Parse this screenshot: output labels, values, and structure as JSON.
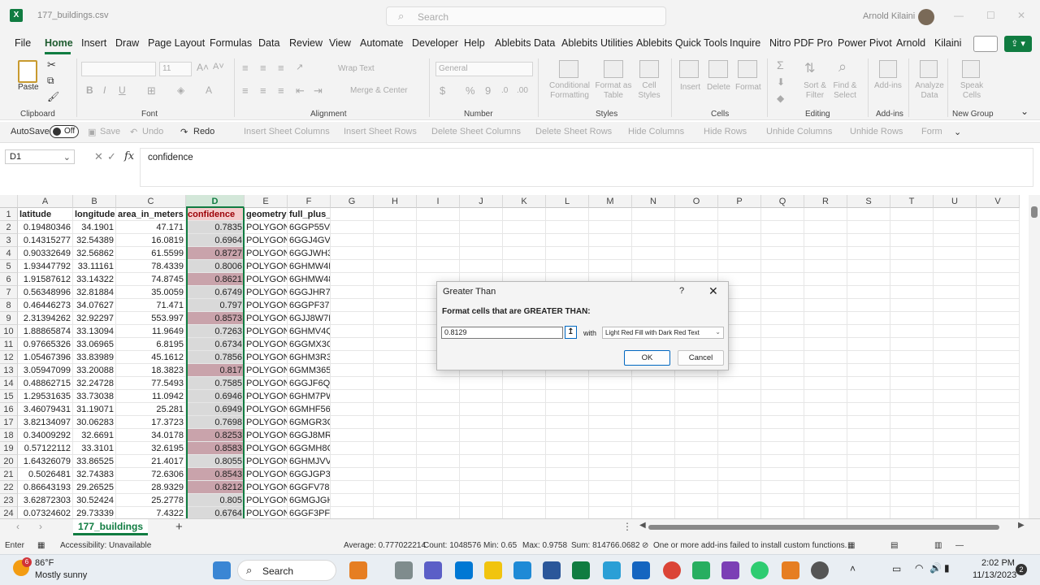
{
  "window": {
    "file_name": "177_buildings.csv",
    "search_placeholder": "Search",
    "user_name": "Arnold Kilaini"
  },
  "menu": [
    "File",
    "Home",
    "Insert",
    "Draw",
    "Page Layout",
    "Formulas",
    "Data",
    "Review",
    "View",
    "Automate",
    "Developer",
    "Help",
    "Ablebits Data",
    "Ablebits Utilities",
    "Ablebits Quick Tools",
    "Inquire",
    "Nitro PDF Pro",
    "Power Pivot",
    "Arnold",
    "Kilaini"
  ],
  "ribbon": {
    "groups": [
      "Clipboard",
      "Font",
      "Alignment",
      "Number",
      "Styles",
      "Cells",
      "Editing",
      "Add-ins",
      "New Group"
    ],
    "paste_label": "Paste",
    "font_size": "11",
    "wrap_text": "Wrap Text",
    "merge_center": "Merge & Center",
    "number_format": "General",
    "conditional_formatting": "Conditional Formatting",
    "format_as_table": "Format as Table",
    "cell_styles": "Cell Styles",
    "insert": "Insert",
    "delete": "Delete",
    "format": "Format",
    "sort_filter": "Sort & Filter",
    "find_select": "Find & Select",
    "addins": "Add-ins",
    "analyze_data": "Analyze Data",
    "speak_cells": "Speak Cells"
  },
  "qat": {
    "autosave": "AutoSave",
    "autosave_state": "Off",
    "save": "Save",
    "undo": "Undo",
    "redo": "Redo",
    "items": [
      "Insert Sheet Columns",
      "Insert Sheet Rows",
      "Delete Sheet Columns",
      "Delete Sheet Rows",
      "Hide Columns",
      "Hide Rows",
      "Unhide Columns",
      "Unhide Rows",
      "Form"
    ]
  },
  "formula_bar": {
    "name_box": "D1",
    "fx": "fx",
    "value": "confidence"
  },
  "grid": {
    "columns": [
      "A",
      "B",
      "C",
      "D",
      "E",
      "F",
      "G",
      "H",
      "I",
      "J",
      "K",
      "L",
      "M",
      "N",
      "O",
      "P",
      "Q",
      "R",
      "S",
      "T",
      "U",
      "V"
    ],
    "headers": [
      "latitude",
      "longitude",
      "area_in_meters",
      "confidence",
      "geometry",
      "full_plus_code"
    ],
    "rows": [
      [
        "0.19480346",
        "34.1901",
        "47.171",
        "0.7835",
        "POLYGON((",
        "6GGP55VR+W2H3"
      ],
      [
        "0.14315277",
        "32.54389",
        "16.0819",
        "0.6964",
        "POLYGON((",
        "6GGJ4GVV+7H64"
      ],
      [
        "0.90332649",
        "32.56862",
        "61.5599",
        "0.8727",
        "POLYGON((",
        "6GGJWH39+8CQ5"
      ],
      [
        "1.93447792",
        "33.11161",
        "78.4339",
        "0.8006",
        "POLYGON((",
        "6GHMW4M6+QJX4"
      ],
      [
        "1.91587612",
        "33.14322",
        "74.8745",
        "0.8621",
        "POLYGON((",
        "6GHMW48V+9752"
      ],
      [
        "0.56348996",
        "32.81884",
        "35.0059",
        "0.6749",
        "POLYGON((",
        "6GGJHR79+9GWH"
      ],
      [
        "0.46446273",
        "34.07627",
        "71.471",
        "0.797",
        "POLYGON((",
        "6GGPF37G+QGJG"
      ],
      [
        "2.31394262",
        "32.92297",
        "553.997",
        "0.8573",
        "POLYGON((",
        "6GJJ8W7F+H5GQ"
      ],
      [
        "1.88865874",
        "33.13094",
        "11.9649",
        "0.7263",
        "POLYGON((",
        "6GHMV4QJ+F979"
      ],
      [
        "0.97665326",
        "33.06965",
        "6.8195",
        "0.6734",
        "POLYGON((",
        "6GGMX3G9+MV64"
      ],
      [
        "1.05467396",
        "33.83989",
        "45.1612",
        "0.7856",
        "POLYGON((",
        "6GHM3R3Q+VX6W"
      ],
      [
        "3.05947099",
        "33.20088",
        "18.3823",
        "0.817",
        "POLYGON((",
        "6GMM3652+Q9JR"
      ],
      [
        "0.48862715",
        "32.24728",
        "77.5493",
        "0.7585",
        "POLYGON((",
        "6GGJF6QW+FW25"
      ],
      [
        "1.29531635",
        "33.73038",
        "11.0942",
        "0.6946",
        "POLYGON((",
        "6GHM7PWJ+45CJ"
      ],
      [
        "3.46079431",
        "31.19071",
        "25.281",
        "0.6949",
        "POLYGON((",
        "6GMHF56R+878P"
      ],
      [
        "3.82134097",
        "30.06283",
        "17.3723",
        "0.7698",
        "POLYGON((",
        "6GMGR3C7+G4PM"
      ],
      [
        "0.34009292",
        "32.6691",
        "34.0178",
        "0.8253",
        "POLYGON((",
        "6GGJ8MR9+2JQJ"
      ],
      [
        "0.57122112",
        "33.3101",
        "32.6195",
        "0.8583",
        "POLYGON((",
        "6GGMH8C6+F2QR"
      ],
      [
        "1.64326079",
        "33.86525",
        "21.4017",
        "0.8055",
        "POLYGON((",
        "6GHMJVV8+842C"
      ],
      [
        "0.5026481",
        "32.74383",
        "72.6306",
        "0.8543",
        "POLYGON((",
        "6GGJGP3V+3G4V"
      ],
      [
        "0.86643193",
        "29.26525",
        "28.9329",
        "0.8212",
        "POLYGON((",
        "6GGFV788+H4C6"
      ],
      [
        "3.62872303",
        "30.52424",
        "25.2778",
        "0.805",
        "POLYGON((",
        "6GMGJGHF+FMQX"
      ],
      [
        "0.07324602",
        "29.73339",
        "7.4322",
        "0.6764",
        "POLYGON((",
        "6GGF3PFM+79RV"
      ]
    ],
    "highlight_rows": [
      3,
      5,
      8,
      12,
      17,
      18,
      20,
      21
    ]
  },
  "sheet_tab": "177_buildings",
  "status_bar": {
    "mode": "Enter",
    "accessibility": "Accessibility: Unavailable",
    "average": "Average: 0.777022214",
    "count": "Count: 1048576",
    "min": "Min: 0.65",
    "max": "Max: 0.9758",
    "sum": "Sum: 814766.0682",
    "addin_warning": "One or more add-ins failed to install custom functions."
  },
  "dialog": {
    "title": "Greater Than",
    "help": "?",
    "close": "✕",
    "prompt": "Format cells that are GREATER THAN:",
    "value": "0.8129",
    "with_label": "with",
    "format_option": "Light Red Fill with Dark Red Text",
    "ok": "OK",
    "cancel": "Cancel"
  },
  "taskbar": {
    "weather_temp": "86°F",
    "weather_desc": "Mostly sunny",
    "weather_badge": "6",
    "search": "Search",
    "time": "2:02 PM",
    "date": "11/13/2023",
    "notif_count": "2"
  },
  "colors": {
    "excel_green": "#107c41",
    "conf_fill": "#d9d9d9",
    "conf_highlight": "#c9a3ab",
    "conf_header_fill": "#f4cccc",
    "dark_red_text": "#9c0006"
  }
}
